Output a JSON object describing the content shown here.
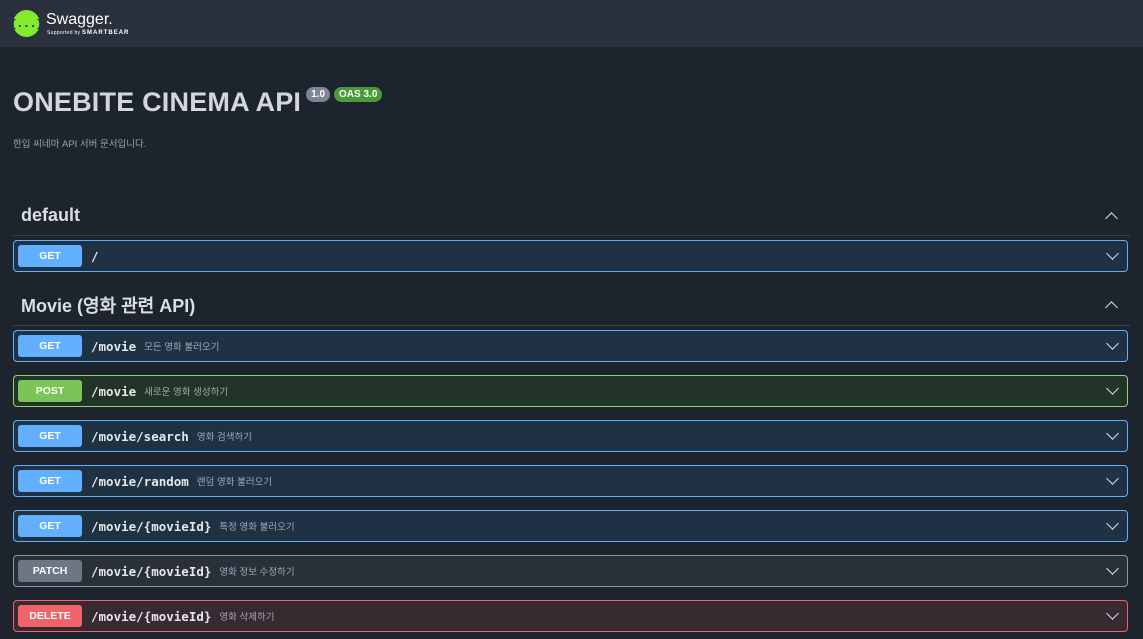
{
  "header": {
    "logo_icon": "{...}",
    "brand": "Swagger.",
    "sub_prefix": "Supported by",
    "sub_brand": "SMARTBEAR"
  },
  "info": {
    "title": "ONEBITE CINEMA API",
    "version": "1.0",
    "oas": "OAS 3.0",
    "description": "한입 씨네마 API 서버 문서입니다."
  },
  "sections": [
    {
      "name": "default",
      "operations": [
        {
          "method": "GET",
          "path": "/",
          "summary": ""
        }
      ]
    },
    {
      "name": "Movie (영화 관련 API)",
      "operations": [
        {
          "method": "GET",
          "path": "/movie",
          "summary": "모든 영화 불러오기"
        },
        {
          "method": "POST",
          "path": "/movie",
          "summary": "새로운 영화 생성하기"
        },
        {
          "method": "GET",
          "path": "/movie/search",
          "summary": "영화 검색하기"
        },
        {
          "method": "GET",
          "path": "/movie/random",
          "summary": "랜덤 영화 불러오기"
        },
        {
          "method": "GET",
          "path": "/movie/{movieId}",
          "summary": "특정 영화 불러오기"
        },
        {
          "method": "PATCH",
          "path": "/movie/{movieId}",
          "summary": "영화 정보 수정하기"
        },
        {
          "method": "DELETE",
          "path": "/movie/{movieId}",
          "summary": "영화 삭제하기"
        }
      ]
    }
  ],
  "colors": {
    "get": "#61affe",
    "post": "#7ac555",
    "patch": "#6e7683",
    "delete": "#f0636b",
    "brand": "#85ea2d"
  }
}
